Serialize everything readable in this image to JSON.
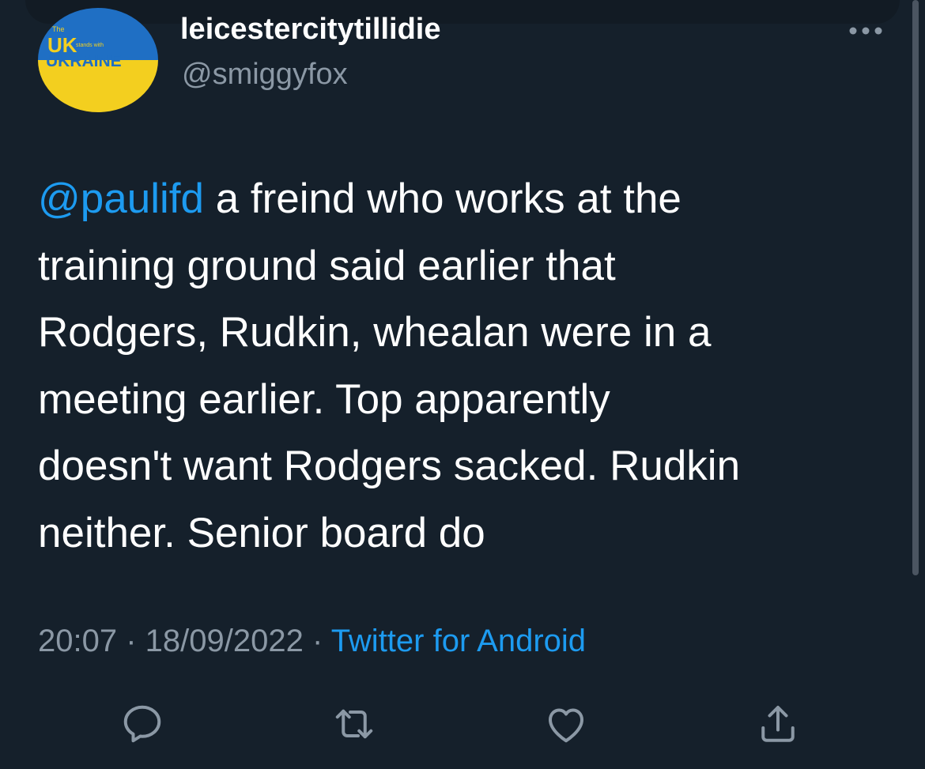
{
  "colors": {
    "background": "#15202b",
    "text": "#ffffff",
    "secondary": "#8b98a5",
    "accent": "#1d9bf0"
  },
  "author": {
    "display_name": "leicestercitytillidie",
    "handle": "@smiggyfox",
    "avatar": {
      "the": "The",
      "uk": "UK",
      "stands_with": "stands with",
      "ukraine": "UKRAINE"
    }
  },
  "tweet": {
    "mention": "@paulifd",
    "lines": [
      "a freind who works at the",
      "training ground said earlier that",
      "Rodgers, Rudkin, whealan were in a",
      "meeting earlier. Top apparently",
      "doesn't want Rodgers sacked. Rudkin",
      "neither. Senior board do"
    ],
    "time": "20:07",
    "date": "18/09/2022",
    "separator": " · ",
    "source": "Twitter for Android"
  },
  "actions": {
    "reply_icon": "reply-icon",
    "retweet_icon": "retweet-icon",
    "like_icon": "heart-icon",
    "share_icon": "share-icon",
    "more_icon": "more-options-icon"
  }
}
